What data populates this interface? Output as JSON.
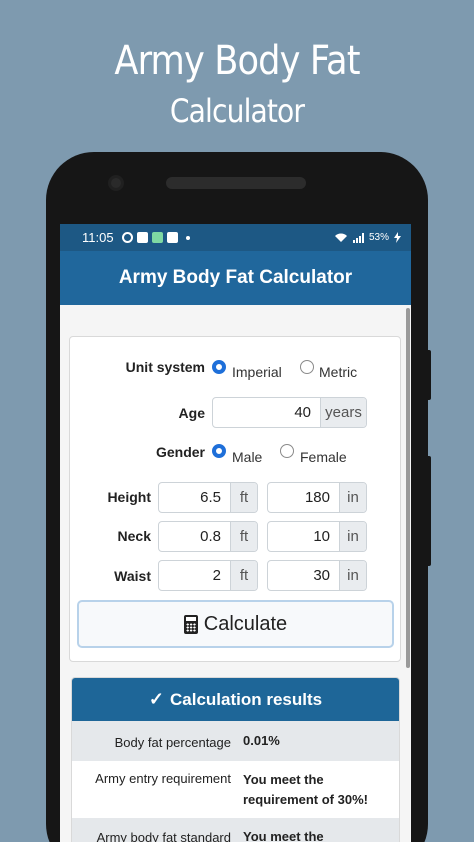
{
  "promo": {
    "title_line1": "Army Body Fat",
    "title_line2": "Calculator"
  },
  "statusbar": {
    "time": "11:05",
    "battery": "53%"
  },
  "appbar": {
    "title": "Army Body Fat Calculator"
  },
  "form": {
    "unit_system": {
      "label": "Unit system",
      "options": [
        "Imperial",
        "Metric"
      ],
      "selected": "Imperial"
    },
    "age": {
      "label": "Age",
      "value": "40",
      "unit": "years"
    },
    "gender": {
      "label": "Gender",
      "options": [
        "Male",
        "Female"
      ],
      "selected": "Male"
    },
    "height": {
      "label": "Height",
      "ft_value": "6.5",
      "ft_unit": "ft",
      "in_value": "180",
      "in_unit": "in"
    },
    "neck": {
      "label": "Neck",
      "ft_value": "0.8",
      "ft_unit": "ft",
      "in_value": "10",
      "in_unit": "in"
    },
    "waist": {
      "label": "Waist",
      "ft_value": "2",
      "ft_unit": "ft",
      "in_value": "30",
      "in_unit": "in"
    },
    "calculate_label": "Calculate"
  },
  "results": {
    "header": "Calculation results",
    "rows": [
      {
        "label": "Body fat percentage",
        "value": "0.01%"
      },
      {
        "label": "Army entry requirement",
        "value": "You meet the requirement of 30%!"
      },
      {
        "label": "Army body fat standard",
        "value": "You meet the"
      }
    ]
  },
  "icons": [
    "whatsapp-icon",
    "lock-icon",
    "messages-icon",
    "chat-icon",
    "wifi-icon",
    "signal-icon",
    "battery-icon",
    "calculator-icon",
    "check-icon"
  ]
}
